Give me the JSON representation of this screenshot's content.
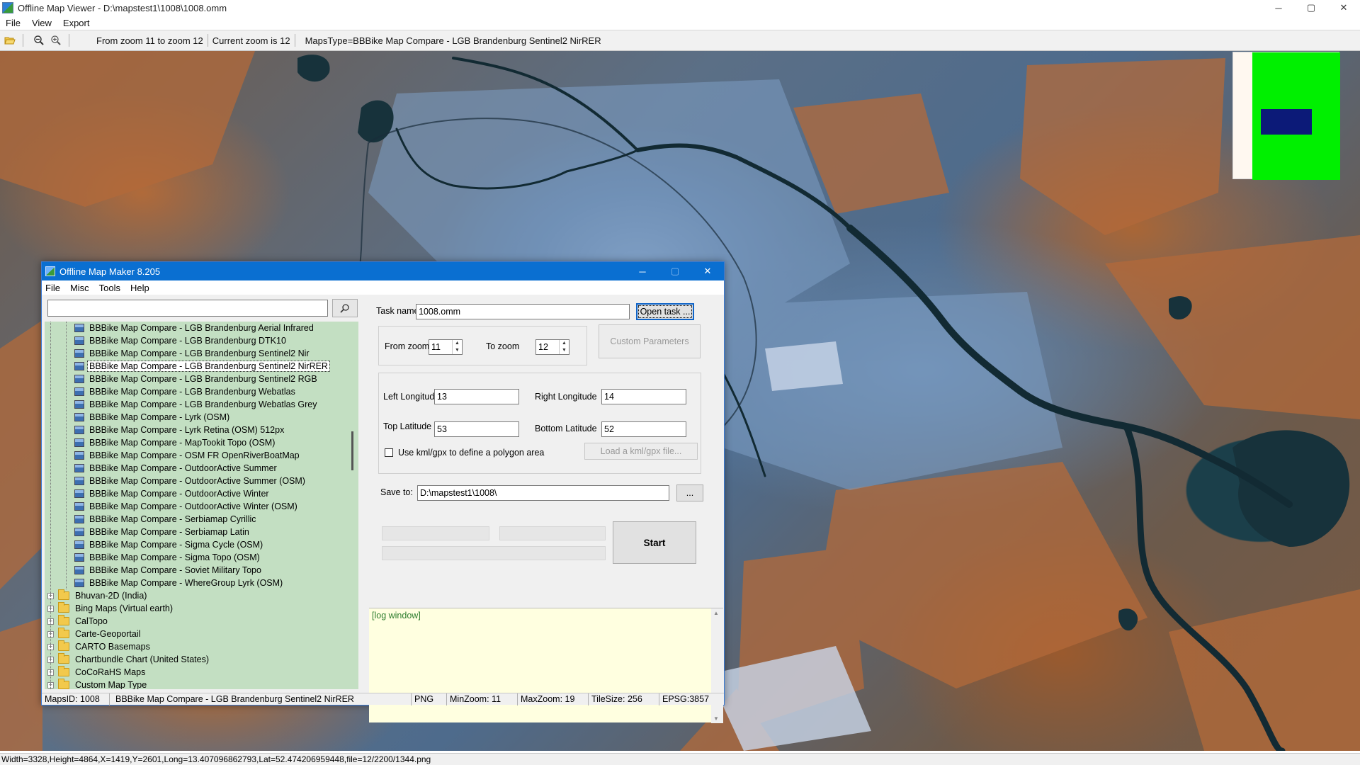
{
  "window": {
    "title": "Offline Map Viewer - D:\\mapstest1\\1008\\1008.omm",
    "controls": {
      "minimize": "─",
      "maximize": "▢",
      "close": "✕"
    }
  },
  "menu": [
    "File",
    "View",
    "Export"
  ],
  "toolbar": {
    "zoom_range": "From zoom 11 to zoom 12",
    "current_zoom": "Current zoom is 12",
    "maps_type": "MapsType=BBBike Map Compare - LGB Brandenburg Sentinel2 NirRER",
    "icons": [
      "open-folder-icon",
      "zoom-out-icon",
      "zoom-in-icon"
    ]
  },
  "overview": {
    "background": "#00f000",
    "view_rect": "#0c1a78"
  },
  "statusbar": {
    "text": "Width=3328,Height=4864,X=1419,Y=2601,Long=13.407096862793,Lat=52.474206959448,file=12/2200/1344.png"
  },
  "dialog": {
    "title": "Offline Map Maker 8.205",
    "controls": {
      "minimize": "─",
      "maximize": "▢",
      "close": "✕"
    },
    "menu": [
      "File",
      "Misc",
      "Tools",
      "Help"
    ],
    "search": {
      "value": "",
      "icon": "search-icon"
    },
    "tree": {
      "children": [
        "BBBike Map Compare - LGB Brandenburg Aerial Infrared",
        "BBBike Map Compare - LGB Brandenburg DTK10",
        "BBBike Map Compare - LGB Brandenburg Sentinel2 Nir",
        "BBBike Map Compare - LGB Brandenburg Sentinel2 NirRER",
        "BBBike Map Compare - LGB Brandenburg Sentinel2 RGB",
        "BBBike Map Compare - LGB Brandenburg Webatlas",
        "BBBike Map Compare - LGB Brandenburg Webatlas Grey",
        "BBBike Map Compare - Lyrk (OSM)",
        "BBBike Map Compare - Lyrk Retina (OSM) 512px",
        "BBBike Map Compare - MapTookit Topo (OSM)",
        "BBBike Map Compare - OSM FR OpenRiverBoatMap",
        "BBBike Map Compare - OutdoorActive Summer",
        "BBBike Map Compare - OutdoorActive Summer (OSM)",
        "BBBike Map Compare - OutdoorActive Winter",
        "BBBike Map Compare - OutdoorActive Winter (OSM)",
        "BBBike Map Compare - Serbiamap Cyrillic",
        "BBBike Map Compare - Serbiamap Latin",
        "BBBike Map Compare - Sigma Cycle (OSM)",
        "BBBike Map Compare - Sigma Topo (OSM)",
        "BBBike Map Compare - Soviet Military Topo",
        "BBBike Map Compare - WhereGroup Lyrk (OSM)"
      ],
      "selected_index": 3,
      "folders": [
        "Bhuvan-2D (India)",
        "Bing Maps (Virtual earth)",
        "CalTopo",
        "Carte-Geoportail",
        "CARTO Basemaps",
        "Chartbundle Chart (United States)",
        "CoCoRaHS Maps",
        "Custom Map Type"
      ],
      "expander": "+"
    },
    "form": {
      "task_name_label": "Task name",
      "task_name": "1008.omm",
      "open_task": "Open task ...",
      "from_zoom_label": "From zoom",
      "from_zoom": "11",
      "to_zoom_label": "To zoom",
      "to_zoom": "12",
      "custom_params": "Custom Parameters",
      "left_lon_label": "Left Longitude",
      "left_lon": "13",
      "right_lon_label": "Right Longitude",
      "right_lon": "14",
      "top_lat_label": "Top Latitude",
      "top_lat": "53",
      "bottom_lat_label": "Bottom Latitude",
      "bottom_lat": "52",
      "use_kml_label": "Use kml/gpx to define a polygon area",
      "load_kml": "Load a kml/gpx file...",
      "save_to_label": "Save to:",
      "save_to": "D:\\mapstest1\\1008\\",
      "browse": "...",
      "start": "Start"
    },
    "log": {
      "text": "[log window]"
    },
    "status": {
      "maps_id": "MapsID: 1008",
      "name": "BBBike Map Compare - LGB Brandenburg Sentinel2 NirRER",
      "format": "PNG",
      "min_zoom": "MinZoom: 11",
      "max_zoom": "MaxZoom: 19",
      "tile_size": "TileSize: 256",
      "epsg": "EPSG:3857"
    }
  }
}
